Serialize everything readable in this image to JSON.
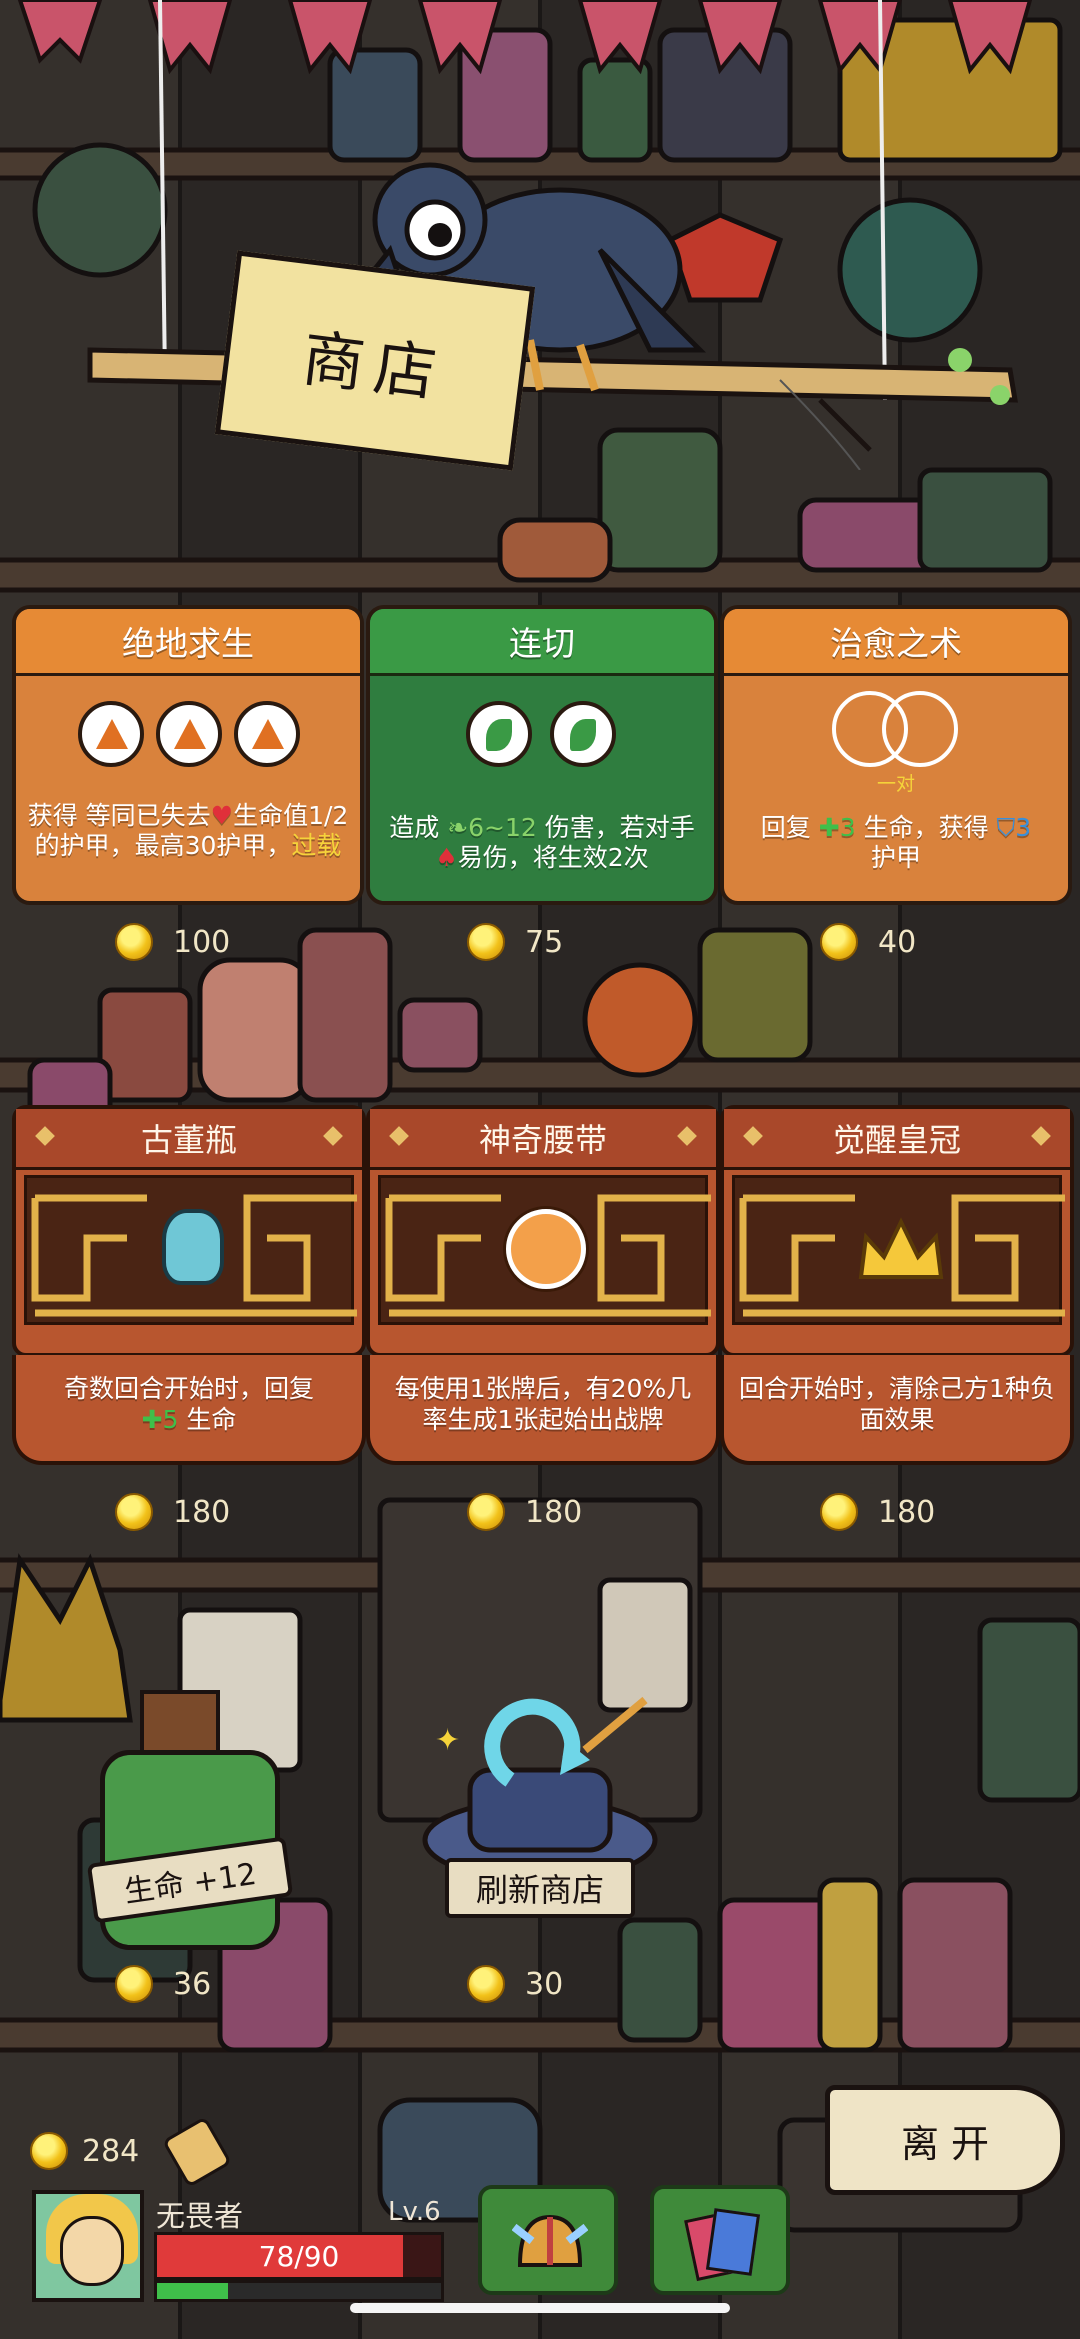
{
  "shop": {
    "title": "商店"
  },
  "skill_cards": [
    {
      "title": "绝地求生",
      "desc_a": "获得 等同已失去",
      "desc_b": "生命值1/2 的护甲，最高30护甲，",
      "desc_keyword": "过载",
      "price": "100",
      "theme": "#d9823c",
      "title_bg": "#e68a35"
    },
    {
      "title": "连切",
      "desc_a": "造成",
      "desc_range": "6~12",
      "desc_b": "伤害，若对手",
      "desc_c": "易伤，将生效2次",
      "price": "75",
      "theme": "#2f7d3f",
      "title_bg": "#3a9a45"
    },
    {
      "title": "治愈之术",
      "pair_label": "一对",
      "desc_a": "回复",
      "desc_heal": "3",
      "desc_b": "生命，获得",
      "desc_armor": "3",
      "desc_c": "护甲",
      "price": "40",
      "theme": "#d9823c",
      "title_bg": "#e68a35"
    }
  ],
  "relics": [
    {
      "title": "古董瓶",
      "desc_a": "奇数回合开始时，回复",
      "desc_heal": "5",
      "desc_b": "生命",
      "price": "180",
      "icon": "vase-icon"
    },
    {
      "title": "神奇腰带",
      "desc": "每使用1张牌后，有20%几率生成1张起始出战牌",
      "price": "180",
      "icon": "belt-icon"
    },
    {
      "title": "觉醒皇冠",
      "desc": "回合开始时，清除己方1种负面效果",
      "price": "180",
      "icon": "crown-icon"
    }
  ],
  "potion": {
    "label": "生命 +12",
    "price": "36"
  },
  "refresh": {
    "label": "刷新商店",
    "price": "30"
  },
  "leave": {
    "label": "离 开"
  },
  "player": {
    "gold": "284",
    "name": "无畏者",
    "level": "Lv.6",
    "hp": "78/90",
    "hp_fraction": 0.867,
    "xp_fraction": 0.25
  },
  "colors": {
    "heart": "#e0303a",
    "heal": "#3fbf4a",
    "armor": "#3a8fd9",
    "keyword": "#f5d33a",
    "blade": "#8ad36a",
    "gold": "#f2c21a"
  }
}
